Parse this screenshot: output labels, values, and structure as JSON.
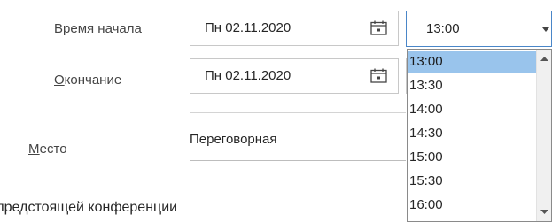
{
  "form": {
    "start_label_pre": "Время н",
    "start_label_ul": "а",
    "start_label_post": "чала",
    "end_label_ul": "О",
    "end_label_post": "кончание",
    "location_label_ul": "М",
    "location_label_post": "есто",
    "start_date": "Пн 02.11.2020",
    "end_date": "Пн 02.11.2020",
    "start_time": "13:00",
    "location_value": "Переговорная",
    "subject_partial": "предстоящей конференции"
  },
  "time_dropdown": {
    "selected": "13:00",
    "options": [
      "13:00",
      "13:30",
      "14:00",
      "14:30",
      "15:00",
      "15:30",
      "16:00"
    ]
  },
  "icons": {
    "calendar": "calendar-icon",
    "dropdown": "chevron-down-icon",
    "scroll_up": "scroll-up-arrow-icon",
    "scroll_down": "scroll-down-arrow-icon"
  },
  "colors": {
    "selection": "#99c4ec",
    "focus_border": "#4a86c8"
  }
}
